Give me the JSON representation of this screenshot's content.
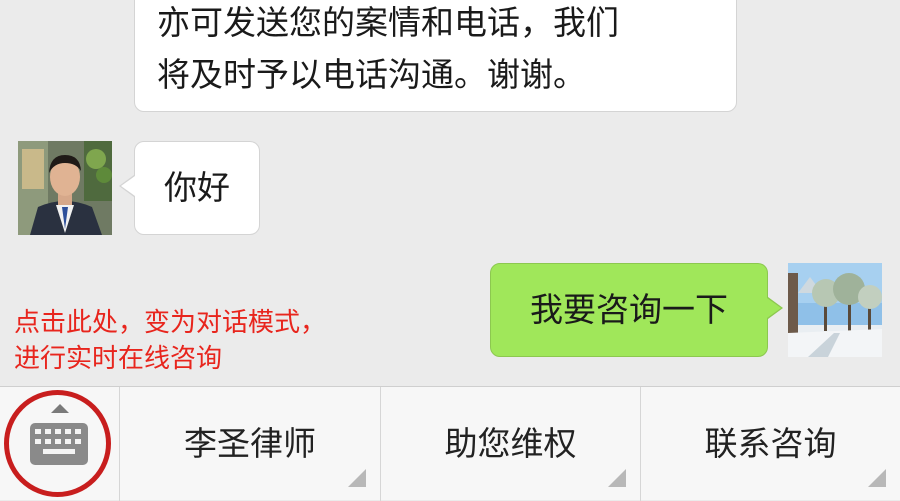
{
  "chat": {
    "top_message": {
      "line1": "亦可发送您的案情和电话，我们",
      "line2": "将及时予以电话沟通。谢谢。"
    },
    "incoming_message": "你好",
    "outgoing_message": "我要咨询一下",
    "hint": {
      "line1": "点击此处，变为对话模式，",
      "line2": "进行实时在线咨询"
    }
  },
  "menu": {
    "items": [
      {
        "label": "李圣律师"
      },
      {
        "label": "助您维权"
      },
      {
        "label": "联系咨询"
      }
    ]
  },
  "colors": {
    "chat_background": "#ebebeb",
    "incoming_bubble": "#ffffff",
    "outgoing_bubble": "#a0e75a",
    "hint_text": "#e8251d",
    "highlight_circle": "#c81e1e"
  },
  "icons": {
    "keyboard_toggle": "keyboard-icon",
    "expand": "chevron-up-icon",
    "submenu_indicator": "corner-triangle-icon"
  }
}
